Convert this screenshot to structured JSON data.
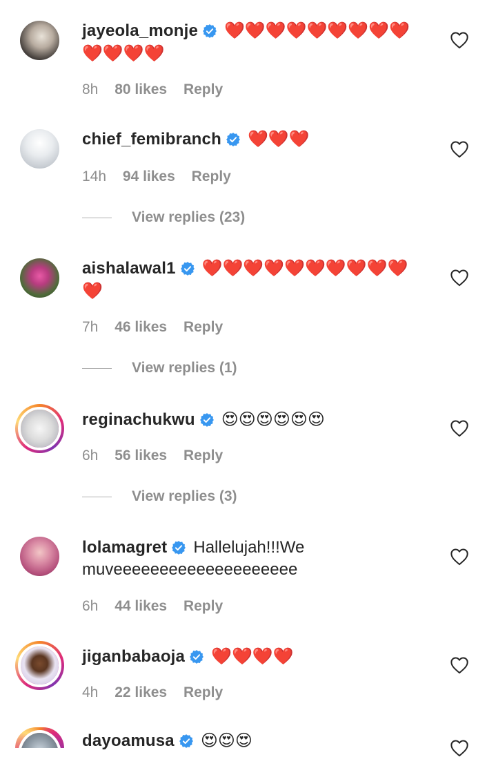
{
  "comments": [
    {
      "username": "jayeola_monje",
      "text": "❤️❤️❤️❤️❤️❤️❤️❤️❤️❤️❤️❤️❤️",
      "time": "8h",
      "likes": "80 likes",
      "reply": "Reply",
      "view_replies": ""
    },
    {
      "username": "chief_femibranch",
      "text": "❤️❤️❤️",
      "time": "14h",
      "likes": "94 likes",
      "reply": "Reply",
      "view_replies": "View replies (23)"
    },
    {
      "username": "aishalawal1",
      "text": "❤️❤️❤️❤️❤️❤️❤️❤️❤️❤️❤️",
      "time": "7h",
      "likes": "46 likes",
      "reply": "Reply",
      "view_replies": "View replies (1)"
    },
    {
      "username": "reginachukwu",
      "text": "😍😍😍😍😍😍",
      "time": "6h",
      "likes": "56 likes",
      "reply": "Reply",
      "view_replies": "View replies (3)"
    },
    {
      "username": "lolamagret",
      "text": "Hallelujah!!!We muveeeeeeeeeeeeeeeeeeee",
      "time": "6h",
      "likes": "44 likes",
      "reply": "Reply",
      "view_replies": ""
    },
    {
      "username": "jiganbabaoja",
      "text": "❤️❤️❤️❤️",
      "time": "4h",
      "likes": "22 likes",
      "reply": "Reply",
      "view_replies": ""
    },
    {
      "username": "dayoamusa",
      "text": "😍😍😍",
      "time": "",
      "likes": "",
      "reply": "",
      "view_replies": ""
    }
  ],
  "colors": {
    "text": "#262626",
    "secondary": "#8e8e8e",
    "verified": "#3897f0",
    "heart": "#e0162b"
  },
  "icons": {
    "verified": "verified-badge-icon",
    "like": "heart-outline-icon"
  }
}
